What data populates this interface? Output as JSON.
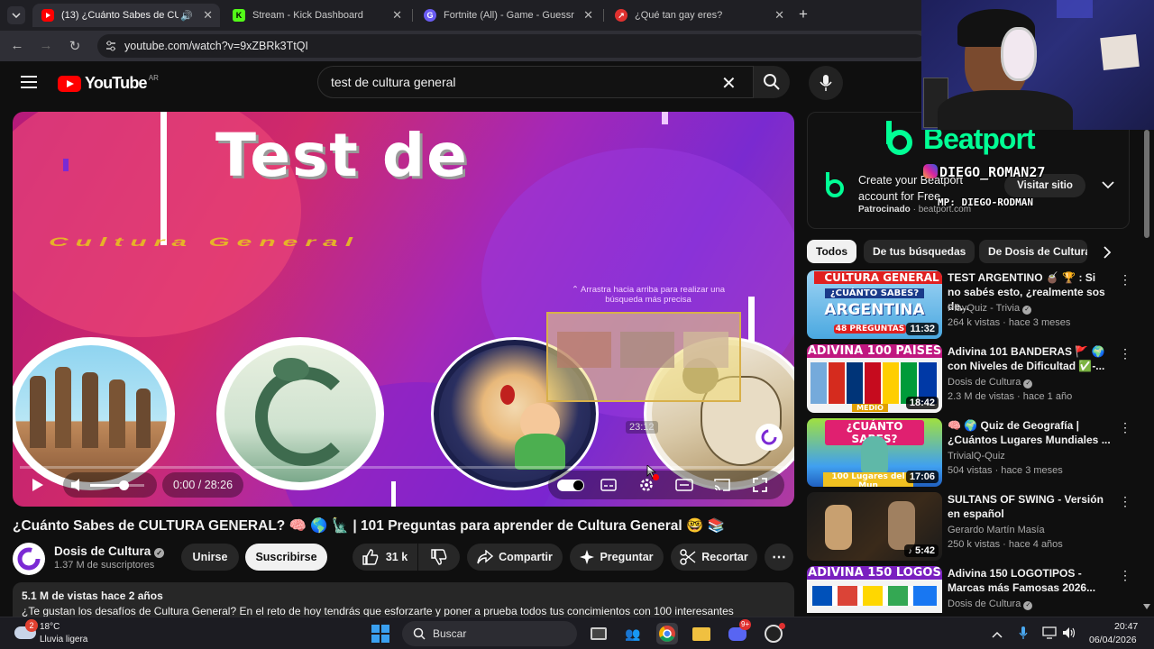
{
  "browser": {
    "tabs": [
      {
        "title": "(13) ¿Cuánto Sabes de CULT",
        "active": true
      },
      {
        "title": "Stream - Kick Dashboard",
        "active": false
      },
      {
        "title": "Fortnite (All) - Game - Guessr",
        "active": false
      },
      {
        "title": "¿Qué tan gay eres?",
        "active": false
      }
    ],
    "new_tab": "+",
    "url": "youtube.com/watch?v=9xZBRk3TtQI"
  },
  "youtube": {
    "logo": "YouTube",
    "country": "AR",
    "search_value": "test de cultura general"
  },
  "video": {
    "thumb_title1": "Test de",
    "thumb_title2": "Cultura General",
    "swipe_hint": "⌃ Arrastra hacia arriba para realizar una búsqueda más precisa",
    "preview_time": "23:12",
    "progress": 0.0,
    "time": "0:00 / 28:26",
    "title": "¿Cuánto Sabes de CULTURA GENERAL? 🧠 🌎 🗽 | 101 Preguntas para aprender de Cultura General 🤓 📚",
    "channel": "Dosis de Cultura",
    "subscribers": "1.37 M de suscriptores",
    "join_label": "Unirse",
    "subscribe_label": "Suscribirse",
    "likes": "31 k",
    "share_label": "Compartir",
    "ask_label": "Preguntar",
    "clip_label": "Recortar",
    "stats": "5.1 M de vistas  hace 2 años",
    "description": "¿Te gustan los desafíos de Cultura General? En el reto de hoy tendrás que esforzarte y poner a prueba todos tus concimientos con 100 interesantes"
  },
  "ad": {
    "brand": "Beatport",
    "headline": "Create your Beatport account for Free",
    "sponsored": "Patrocinado",
    "domain": "beatport.com",
    "cta": "Visitar sitio",
    "streamer_handle": "DIEGO_ROMAN27",
    "mp_text": "MP: DIEGO-RODMAN"
  },
  "chips": [
    "Todos",
    "De tus búsquedas",
    "De Dosis de Cultura"
  ],
  "recommendations": [
    {
      "title": "TEST ARGENTINO 🧉 🏆 : Si no sabés esto, ¿realmente sos de...",
      "channel": "PlayQuiz - Trivia",
      "meta": "264 k vistas · hace 3 meses",
      "duration": "11:32",
      "thumb_top": "CULTURA GENERAL",
      "thumb_mid": "¿CUÁNTO SABES?",
      "thumb_big": "ARGENTINA",
      "thumb_bottom": "48 PREGUNTAS"
    },
    {
      "title": "Adivina 101 BANDERAS 🚩 🌍 con Niveles de Dificultad ✅-...",
      "channel": "Dosis de Cultura",
      "meta": "2.3 M de vistas · hace 1 año",
      "duration": "18:42",
      "thumb_top": "ADIVINA 100 PAÍSES",
      "thumb_bottom": "MEDIO"
    },
    {
      "title": "🧠 🌍 Quiz de Geografía | ¿Cuántos Lugares Mundiales ...",
      "channel": "TrivialQ-Quiz",
      "meta": "504 vistas · hace 3 meses",
      "duration": "17:06",
      "thumb_top": "¿CUÁNTO SABES?",
      "thumb_bottom": "100 Lugares del Mun"
    },
    {
      "title": "SULTANS OF SWING - Versión en español",
      "channel": "Gerardo Martín Masía",
      "meta": "250 k vistas · hace 4 años",
      "duration": "5:42",
      "thumb_top": "",
      "thumb_bottom": ""
    },
    {
      "title": "Adivina 150 LOGOTIPOS - Marcas más Famosas 2026...",
      "channel": "Dosis de Cultura",
      "meta": "",
      "duration": "",
      "thumb_top": "ADIVINA 150 LOGOS",
      "thumb_bottom": ""
    }
  ],
  "taskbar": {
    "temp": "18°C",
    "weather": "Lluvia ligera",
    "search": "Buscar",
    "time": "20:47",
    "date": "06/04/2026",
    "weather_badge": "2",
    "discord_badge": "9+"
  },
  "colors": {
    "accent": "#ff0000",
    "bg": "#0f0f0f",
    "pill": "#272727"
  }
}
